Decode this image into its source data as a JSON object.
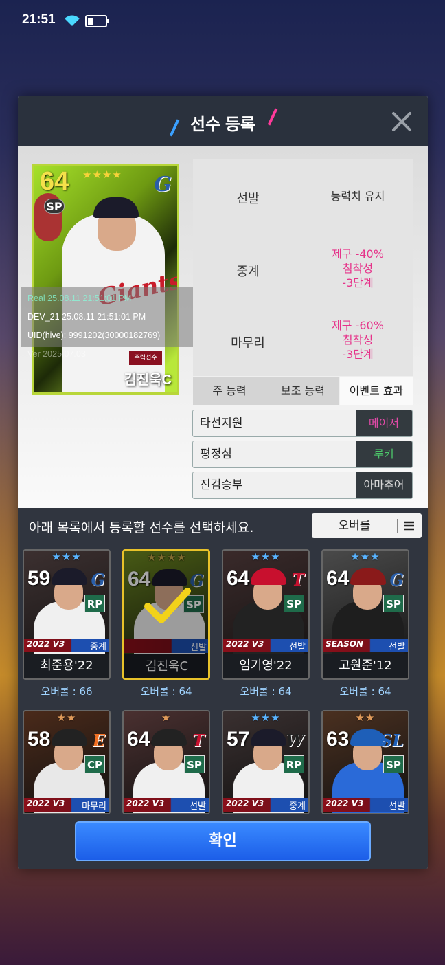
{
  "status": {
    "time": "21:51"
  },
  "modal": {
    "title": "선수 등록"
  },
  "player_card": {
    "overall": "64",
    "position": "SP",
    "stars": "★★★★",
    "team_logo": "G",
    "tag": "주력선수",
    "name": "김진욱C",
    "team_script": "Giants"
  },
  "debug": {
    "real": "Real   25.08.11 21:51:01 PM",
    "dev": "DEV_21   25.08.11 21:51:01 PM",
    "uid": "UID(hive): 9991202(30000182769)",
    "ver": "Ver   2025.07.03"
  },
  "ability_table": [
    {
      "role": "선발",
      "effect": [
        "능력치 유지"
      ],
      "color": "#333333"
    },
    {
      "role": "중계",
      "effect": [
        "제구 -40%",
        "침착성",
        "-3단계"
      ],
      "color": "#e6338a"
    },
    {
      "role": "마무리",
      "effect": [
        "제구 -60%",
        "침착성",
        "-3단계"
      ],
      "color": "#e6338a"
    }
  ],
  "tabs": [
    "주 능력",
    "보조 능력",
    "이벤트 효과"
  ],
  "active_tab": 2,
  "effects": [
    {
      "name": "타선지원",
      "grade": "메이저",
      "grade_color": "#e24aa8"
    },
    {
      "name": "평정심",
      "grade": "루키",
      "grade_color": "#4cc56a"
    },
    {
      "name": "진검승부",
      "grade": "아마추어",
      "grade_color": "#d8d8d8"
    }
  ],
  "instruction": "아래 목록에서 등록할 선수를 선택하세요.",
  "sort": {
    "label": "오버롤"
  },
  "cards": [
    {
      "ovr": "59",
      "stars": "★★★",
      "star_color": "#5ab4ff",
      "team": "G",
      "team_color": "#2a5ea8",
      "pos": "RP",
      "pos_color": "#1f6b4a",
      "year": "2022 V3",
      "role": "중계",
      "name": "최준용'22",
      "overall_label": "오버롤 : 66",
      "bg": "#3c3030",
      "jersey": "#f0f0f0",
      "cap": "#1b1b2a"
    },
    {
      "ovr": "64",
      "stars": "★★★★",
      "star_color": "#c8a84a",
      "team": "G",
      "team_color": "#2a5ea8",
      "pos": "SP",
      "pos_color": "#1f6b4a",
      "year": "",
      "role": "선발",
      "name": "김진욱C",
      "overall_label": "오버롤 : 64",
      "bg": "#6e8a20",
      "jersey": "#f0f0f0",
      "cap": "#1b1b2a",
      "selected": true
    },
    {
      "ovr": "64",
      "stars": "★★★",
      "star_color": "#5ab4ff",
      "team": "T",
      "team_color": "#c8102e",
      "pos": "SP",
      "pos_color": "#1f6b4a",
      "year": "2022 V3",
      "role": "선발",
      "name": "임기영'22",
      "overall_label": "오버롤 : 64",
      "bg": "#3a2a2a",
      "jersey": "#222222",
      "cap": "#c8102e"
    },
    {
      "ovr": "64",
      "stars": "★★★",
      "star_color": "#5ab4ff",
      "team": "G",
      "team_color": "#2a5ea8",
      "pos": "SP",
      "pos_color": "#1f6b4a",
      "year": "SEASON",
      "role": "선발",
      "name": "고원준'12",
      "overall_label": "오버롤 : 64",
      "bg": "#4a4a4a",
      "jersey": "#1e1e1e",
      "cap": "#8a1a1a"
    },
    {
      "ovr": "58",
      "stars": "★★",
      "star_color": "#e09a5a",
      "team": "E",
      "team_color": "#f36f21",
      "pos": "CP",
      "pos_color": "#1f6b4a",
      "year": "2022 V3",
      "role": "마무리",
      "name": "",
      "overall_label": "",
      "bg": "#4a2a1a",
      "jersey": "#e8e8e8",
      "cap": "#222222"
    },
    {
      "ovr": "64",
      "stars": "★",
      "star_color": "#e09a5a",
      "team": "T",
      "team_color": "#c8102e",
      "pos": "SP",
      "pos_color": "#1f6b4a",
      "year": "2022 V3",
      "role": "선발",
      "name": "",
      "overall_label": "",
      "bg": "#4a3030",
      "jersey": "#f0f0f0",
      "cap": "#222222"
    },
    {
      "ovr": "57",
      "stars": "★★★",
      "star_color": "#5ab4ff",
      "team": "W",
      "team_color": "#222222",
      "pos": "RP",
      "pos_color": "#1f6b4a",
      "year": "2022 V3",
      "role": "중계",
      "name": "",
      "overall_label": "",
      "bg": "#3a3030",
      "jersey": "#f0f0f0",
      "cap": "#1b1b2a"
    },
    {
      "ovr": "63",
      "stars": "★★",
      "star_color": "#e09a5a",
      "team": "SL",
      "team_color": "#1e5fb8",
      "pos": "SP",
      "pos_color": "#1f6b4a",
      "year": "2022 V3",
      "role": "선발",
      "name": "",
      "overall_label": "",
      "bg": "#4a3020",
      "jersey": "#2a6ad8",
      "cap": "#1e5fb8"
    }
  ],
  "confirm": {
    "label": "확인"
  }
}
